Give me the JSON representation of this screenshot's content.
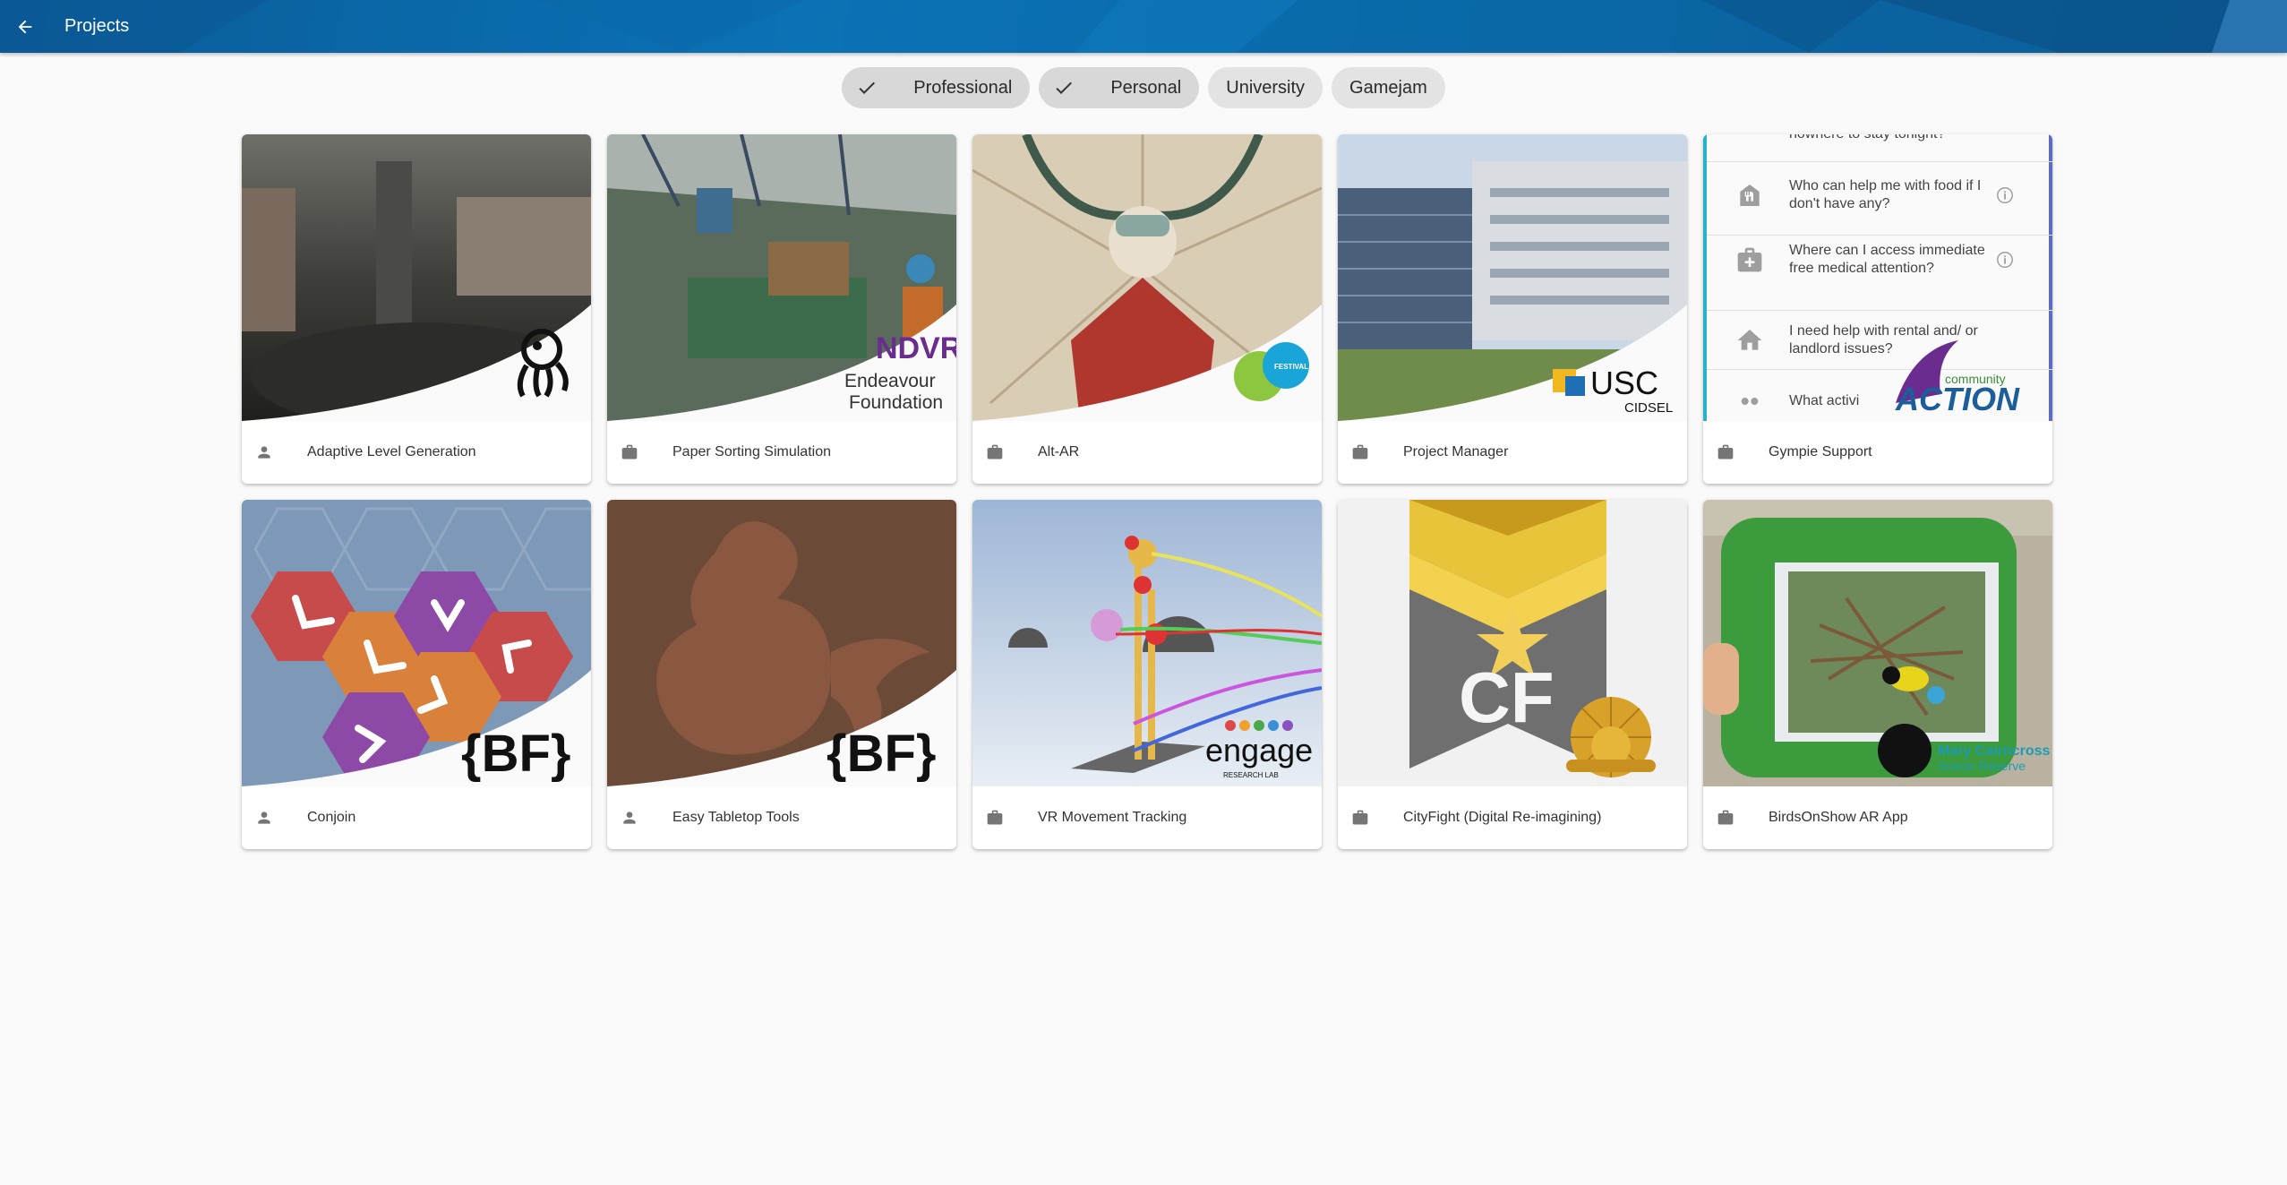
{
  "appbar": {
    "title": "Projects",
    "back_icon": "arrow-back-icon",
    "background": "#0b6aab"
  },
  "filters": [
    {
      "label": "Professional",
      "selected": true
    },
    {
      "label": "Personal",
      "selected": true
    },
    {
      "label": "University",
      "selected": false
    },
    {
      "label": "Gamejam",
      "selected": false
    }
  ],
  "projects": [
    {
      "title": "Adaptive Level Generation",
      "type_icon": "person-icon"
    },
    {
      "title": "Paper Sorting Simulation",
      "type_icon": "briefcase-icon",
      "logo_text": [
        "Endeavour",
        "Foundation"
      ]
    },
    {
      "title": "Alt-AR",
      "type_icon": "briefcase-icon"
    },
    {
      "title": "Project Manager",
      "type_icon": "briefcase-icon",
      "logo_text": [
        "USC",
        "CIDSEL"
      ]
    },
    {
      "title": "Gympie Support",
      "type_icon": "briefcase-icon",
      "logo_text": [
        "ACTION"
      ]
    },
    {
      "title": "Conjoin",
      "type_icon": "person-icon",
      "logo_text": [
        "{BF}"
      ]
    },
    {
      "title": "Easy Tabletop Tools",
      "type_icon": "person-icon",
      "logo_text": [
        "{BF}"
      ]
    },
    {
      "title": "VR Movement Tracking",
      "type_icon": "briefcase-icon",
      "logo_text": [
        "engage",
        "RESEARCH LAB"
      ]
    },
    {
      "title": "CityFight (Digital Re-imagining)",
      "type_icon": "briefcase-icon",
      "logo_text": [
        "CF"
      ]
    },
    {
      "title": "BirdsOnShow AR App",
      "type_icon": "briefcase-icon",
      "logo_text": [
        "Mary Cairncross",
        "Scenic Reserve"
      ]
    }
  ],
  "gympie_list": [
    {
      "text": "nowhere to stay tonight?",
      "icon": "bed-icon"
    },
    {
      "text": "Who can help me with food if I don't have any?",
      "icon": "food-icon"
    },
    {
      "text": "Where can I access immediate free medical attention?",
      "icon": "medical-icon"
    },
    {
      "text": "I need help with rental and/ or landlord issues?",
      "icon": "home-icon"
    },
    {
      "text": "What activi",
      "icon": "people-icon"
    }
  ]
}
